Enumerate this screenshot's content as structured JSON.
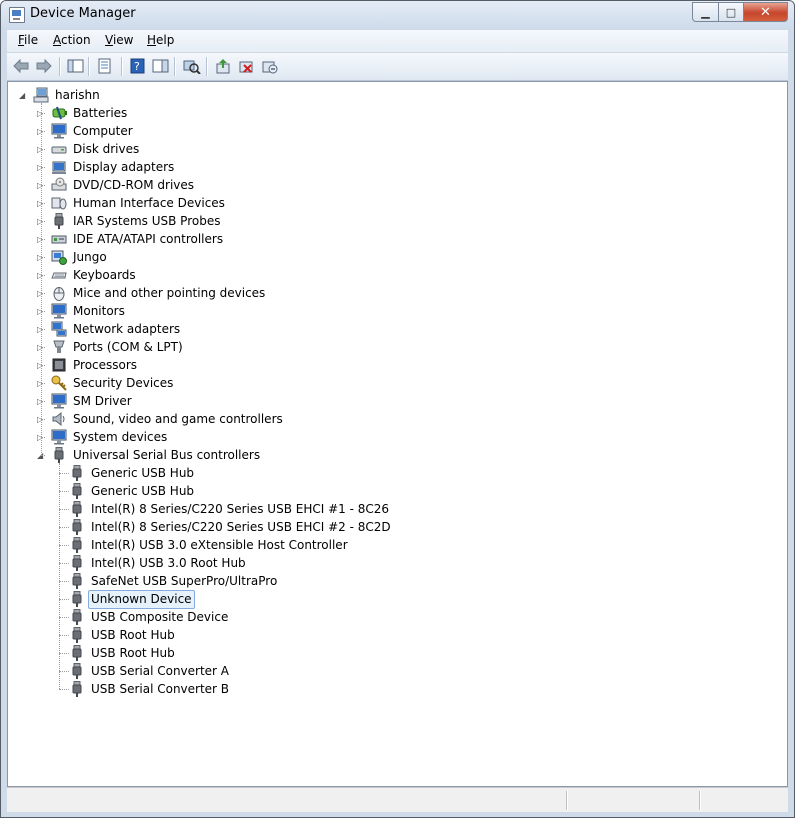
{
  "window": {
    "title": "Device Manager"
  },
  "menu": [
    {
      "label": "File",
      "accel": "F",
      "rest": "ile"
    },
    {
      "label": "Action",
      "accel": "A",
      "rest": "ction"
    },
    {
      "label": "View",
      "accel": "V",
      "rest": "iew"
    },
    {
      "label": "Help",
      "accel": "H",
      "rest": "elp"
    }
  ],
  "toolbar": {
    "icons": [
      "back-icon",
      "forward-icon",
      "show-hide-console-tree-icon",
      "properties-icon",
      "help-icon",
      "show-action-pane-icon",
      "scan-hardware-icon",
      "update-driver-icon",
      "uninstall-icon",
      "disable-icon"
    ]
  },
  "tree": {
    "root": {
      "label": "harishn",
      "icon": "computer-root-icon"
    },
    "categories": [
      {
        "label": "Batteries",
        "icon": "battery-icon",
        "expanded": false
      },
      {
        "label": "Computer",
        "icon": "monitor-icon",
        "expanded": false
      },
      {
        "label": "Disk drives",
        "icon": "disk-drive-icon",
        "expanded": false
      },
      {
        "label": "Display adapters",
        "icon": "display-adapter-icon",
        "expanded": false
      },
      {
        "label": "DVD/CD-ROM drives",
        "icon": "dvd-drive-icon",
        "expanded": false
      },
      {
        "label": "Human Interface Devices",
        "icon": "hid-icon",
        "expanded": false
      },
      {
        "label": "IAR Systems USB Probes",
        "icon": "usb-plug-icon",
        "expanded": false
      },
      {
        "label": "IDE ATA/ATAPI controllers",
        "icon": "ide-controller-icon",
        "expanded": false
      },
      {
        "label": "Jungo",
        "icon": "jungo-icon",
        "expanded": false
      },
      {
        "label": "Keyboards",
        "icon": "keyboard-icon",
        "expanded": false
      },
      {
        "label": "Mice and other pointing devices",
        "icon": "mouse-icon",
        "expanded": false
      },
      {
        "label": "Monitors",
        "icon": "monitor-icon",
        "expanded": false
      },
      {
        "label": "Network adapters",
        "icon": "network-icon",
        "expanded": false
      },
      {
        "label": "Ports (COM & LPT)",
        "icon": "port-icon",
        "expanded": false
      },
      {
        "label": "Processors",
        "icon": "processor-icon",
        "expanded": false
      },
      {
        "label": "Security Devices",
        "icon": "key-icon",
        "expanded": false
      },
      {
        "label": "SM Driver",
        "icon": "monitor-icon",
        "expanded": false
      },
      {
        "label": "Sound, video and game controllers",
        "icon": "speaker-icon",
        "expanded": false
      },
      {
        "label": "System devices",
        "icon": "monitor-icon",
        "expanded": false
      },
      {
        "label": "Universal Serial Bus controllers",
        "icon": "usb-plug-icon",
        "expanded": true
      }
    ],
    "usb_children": [
      {
        "label": "Generic USB Hub",
        "selected": false
      },
      {
        "label": "Generic USB Hub",
        "selected": false
      },
      {
        "label": "Intel(R) 8 Series/C220 Series  USB EHCI #1 - 8C26",
        "selected": false
      },
      {
        "label": "Intel(R) 8 Series/C220 Series  USB EHCI #2 - 8C2D",
        "selected": false
      },
      {
        "label": "Intel(R) USB 3.0 eXtensible Host Controller",
        "selected": false
      },
      {
        "label": "Intel(R) USB 3.0 Root Hub",
        "selected": false
      },
      {
        "label": "SafeNet USB SuperPro/UltraPro",
        "selected": false
      },
      {
        "label": "Unknown Device",
        "selected": true
      },
      {
        "label": "USB Composite Device",
        "selected": false
      },
      {
        "label": "USB Root Hub",
        "selected": false
      },
      {
        "label": "USB Root Hub",
        "selected": false
      },
      {
        "label": "USB Serial Converter A",
        "selected": false
      },
      {
        "label": "USB Serial Converter B",
        "selected": false
      }
    ]
  },
  "colors": {
    "titlebar": "#dce6f2",
    "selection": "#e5f1fb",
    "selection_border": "#84acdd",
    "close_button": "#c6462c"
  }
}
